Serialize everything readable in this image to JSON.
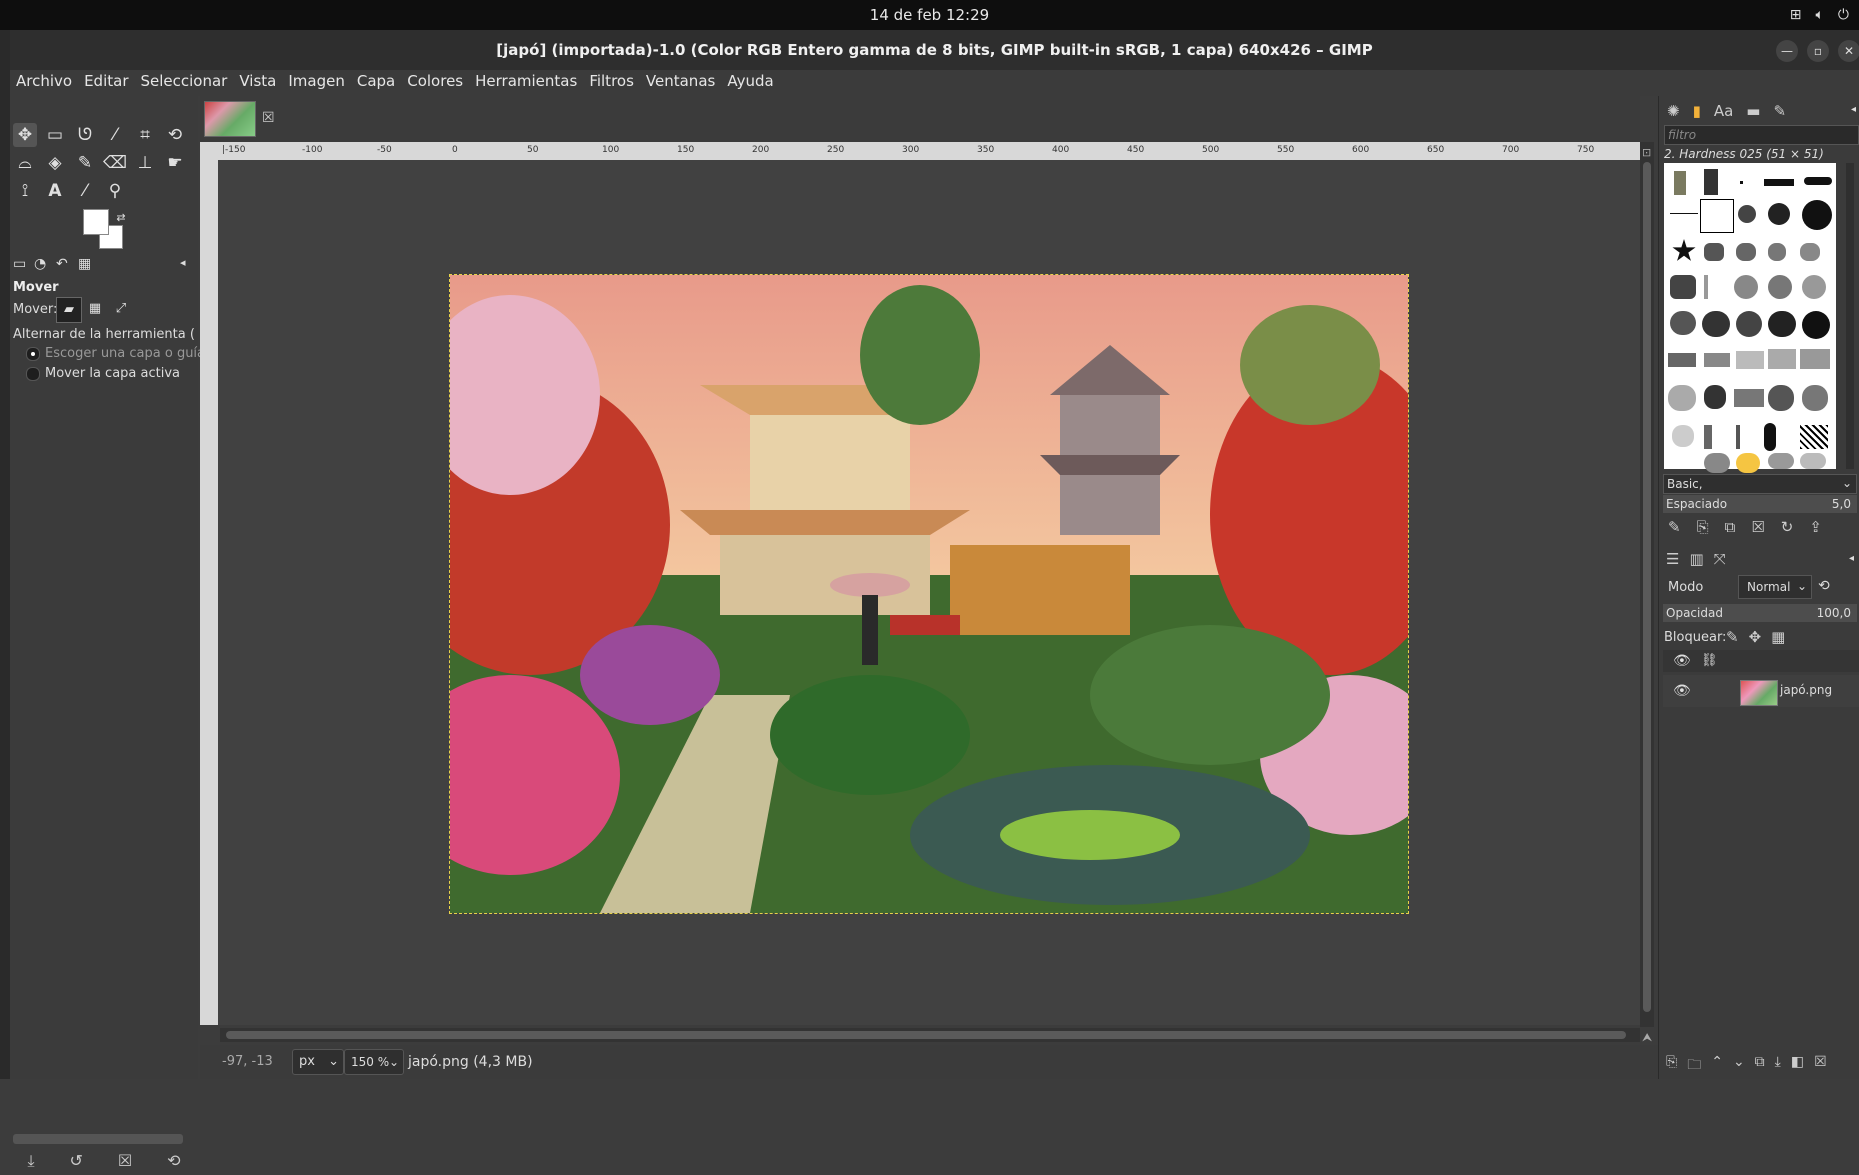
{
  "system": {
    "clock": "14 de feb  12:29",
    "tray_icons": [
      "network-icon",
      "volume-icon",
      "power-icon"
    ]
  },
  "window": {
    "title": "[japó] (importada)-1.0 (Color RGB Entero gamma de 8 bits, GIMP built-in sRGB, 1 capa) 640x426 – GIMP"
  },
  "menu": [
    "Archivo",
    "Editar",
    "Seleccionar",
    "Vista",
    "Imagen",
    "Capa",
    "Colores",
    "Herramientas",
    "Filtros",
    "Ventanas",
    "Ayuda"
  ],
  "tool_options": {
    "title": "Mover",
    "move_label": "Mover:",
    "toggle_label": "Alternar de la herramienta  (Mayú",
    "option_pick": "Escoger una capa o guía",
    "option_active": "Mover la capa activa"
  },
  "ruler": {
    "h_ticks": [
      "-100",
      "-50",
      "0",
      "50",
      "100",
      "150",
      "200",
      "250",
      "300",
      "350",
      "400",
      "450",
      "500",
      "550",
      "600",
      "650",
      "700",
      "750"
    ],
    "h_prefix": "|-150"
  },
  "status": {
    "coords": "-97, -13",
    "unit": "px",
    "zoom": "150 %",
    "file_info": "japó.png (4,3 MB)"
  },
  "brushes": {
    "filter_placeholder": "filtro",
    "selected": "2. Hardness 025 (51 × 51)",
    "preset": "Basic,",
    "spacing_label": "Espaciado",
    "spacing_value": "5,0"
  },
  "layers": {
    "mode_label": "Modo",
    "mode_value": "Normal",
    "opacity_label": "Opacidad",
    "opacity_value": "100,0",
    "lock_label": "Bloquear:",
    "items": [
      {
        "name": "japó.png",
        "visible": true
      }
    ]
  }
}
